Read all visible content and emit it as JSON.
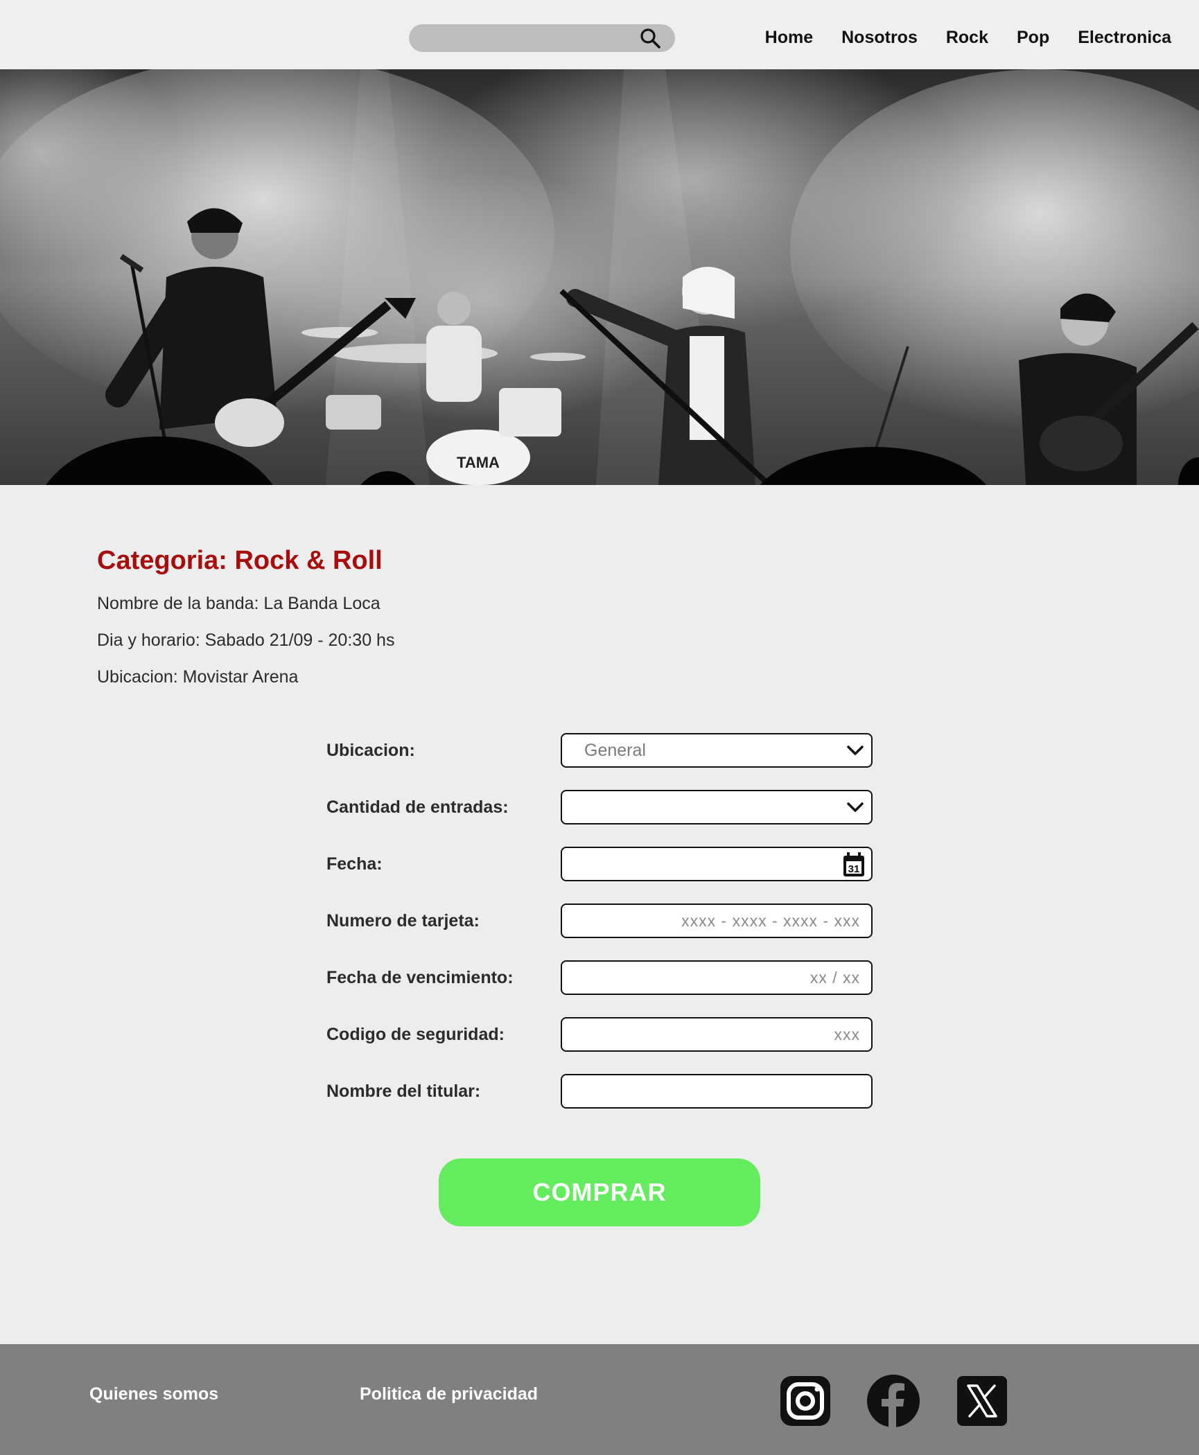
{
  "header": {
    "search_placeholder": "",
    "nav": [
      "Home",
      "Nosotros",
      "Rock",
      "Pop",
      "Electronica"
    ]
  },
  "event": {
    "category": "Categoria: Rock & Roll",
    "band": "Nombre de la banda: La Banda Loca",
    "datetime": "Dia y horario: Sabado 21/09 - 20:30 hs",
    "venue": "Ubicacion: Movistar Arena"
  },
  "form": {
    "ubicacion_label": "Ubicacion:",
    "ubicacion_value": "General",
    "cantidad_label": "Cantidad de entradas:",
    "cantidad_value": "",
    "fecha_label": "Fecha:",
    "fecha_value": "",
    "calendar_day": "31",
    "tarjeta_label": "Numero de tarjeta:",
    "tarjeta_placeholder": "xxxx - xxxx - xxxx - xxx",
    "vencimiento_label": "Fecha de vencimiento:",
    "vencimiento_placeholder": "xx / xx",
    "codigo_label": "Codigo de seguridad:",
    "codigo_placeholder": "xxx",
    "titular_label": "Nombre del titular:",
    "titular_placeholder": "",
    "submit_label": "COMPRAR"
  },
  "footer": {
    "quienes": "Quienes somos",
    "privacidad": "Politica de privacidad",
    "socials": [
      "instagram-icon",
      "facebook-icon",
      "x-icon"
    ]
  },
  "colors": {
    "accent_red": "#a70d0d",
    "buy_green": "#63ec5d",
    "footer_gray": "#808080",
    "search_gray": "#bdbdbd"
  }
}
